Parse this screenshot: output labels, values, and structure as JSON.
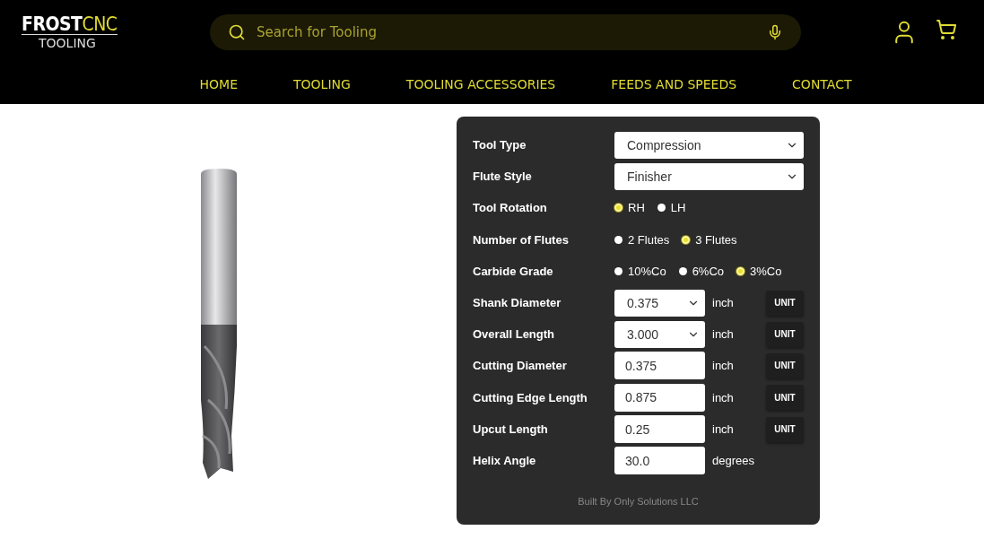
{
  "logo": {
    "main": "FROST",
    "accent": "CNC",
    "sub": "TOOLING"
  },
  "search": {
    "placeholder": "Search for Tooling"
  },
  "nav": [
    "HOME",
    "TOOLING",
    "TOOLING ACCESSORIES",
    "FEEDS AND SPEEDS",
    "CONTACT"
  ],
  "form": {
    "rows": [
      {
        "kind": "select",
        "label": "Tool Type",
        "value": "Compression"
      },
      {
        "kind": "select",
        "label": "Flute Style",
        "value": "Finisher"
      },
      {
        "kind": "radio",
        "label": "Tool Rotation",
        "options": [
          {
            "label": "RH",
            "selected": true
          },
          {
            "label": "LH",
            "selected": false
          }
        ]
      },
      {
        "kind": "radio",
        "label": "Number of Flutes",
        "options": [
          {
            "label": "2 Flutes",
            "selected": false
          },
          {
            "label": "3 Flutes",
            "selected": true
          }
        ]
      },
      {
        "kind": "radio",
        "label": "Carbide Grade",
        "options": [
          {
            "label": "10%Co",
            "selected": false
          },
          {
            "label": "6%Co",
            "selected": false
          },
          {
            "label": "3%Co",
            "selected": true
          }
        ]
      },
      {
        "kind": "select_unit",
        "label": "Shank Diameter",
        "value": "0.375",
        "unit": "inch",
        "button": "UNIT"
      },
      {
        "kind": "select_unit",
        "label": "Overall Length",
        "value": "3.000",
        "unit": "inch",
        "button": "UNIT"
      },
      {
        "kind": "input_unit",
        "label": "Cutting Diameter",
        "value": "0.375",
        "unit": "inch",
        "button": "UNIT"
      },
      {
        "kind": "input_unit",
        "label": "Cutting Edge Length",
        "value": "0.875",
        "unit": "inch",
        "button": "UNIT"
      },
      {
        "kind": "input_unit",
        "label": "Upcut Length",
        "value": "0.25",
        "unit": "inch",
        "button": "UNIT"
      },
      {
        "kind": "input",
        "label": "Helix Angle",
        "value": "30.0",
        "unit": "degrees"
      }
    ],
    "footer": "Built By Only Solutions LLC"
  }
}
